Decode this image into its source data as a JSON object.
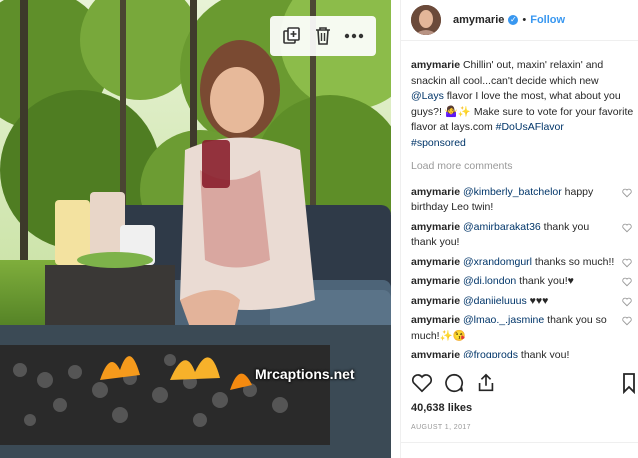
{
  "photo": {
    "watermark": "Mrcaptions.net",
    "toolbar": {
      "copy_icon": "copy-icon",
      "delete_icon": "trash-icon",
      "more_icon": "more-icon"
    }
  },
  "header": {
    "username": "amymarie",
    "verified_symbol": "✓",
    "separator": "•",
    "follow_label": "Follow"
  },
  "caption": {
    "username": "amymarie",
    "text_1": "Chillin' out, maxin' relaxin' and snackin all cool...can't decide which new ",
    "mention": "@Lays",
    "text_2": " flavor I love the most, what about you guys?! 🤷‍♀️✨ Make sure to vote for your favorite flavor at lays.com ",
    "hashtag_1": "#DoUsAFlavor",
    "hashtag_2": "#sponsored"
  },
  "load_more": "Load more comments",
  "comments": [
    {
      "user": "amymarie",
      "mention": "@kimberly_batchelor",
      "text": " happy birthday Leo twin!"
    },
    {
      "user": "amymarie",
      "mention": "@amirbarakat36",
      "text": " thank you thank you!"
    },
    {
      "user": "amymarie",
      "mention": "@xrandomgurl",
      "text": " thanks so much!!"
    },
    {
      "user": "amymarie",
      "mention": "@di.london",
      "text": " thank you!♥"
    },
    {
      "user": "amymarie",
      "mention": "@daniieluuus",
      "text": " ♥♥♥"
    },
    {
      "user": "amymarie",
      "mention": "@lmao._.jasmine",
      "text": " thank you so much!✨😘"
    },
    {
      "user": "amymarie",
      "mention": "@frogprods",
      "text": " thank you! "
    }
  ],
  "likes": "40,638 likes",
  "date": "AUGUST 1, 2017",
  "colors": {
    "accent": "#3897f0",
    "mention": "#003569",
    "muted": "#999999"
  }
}
